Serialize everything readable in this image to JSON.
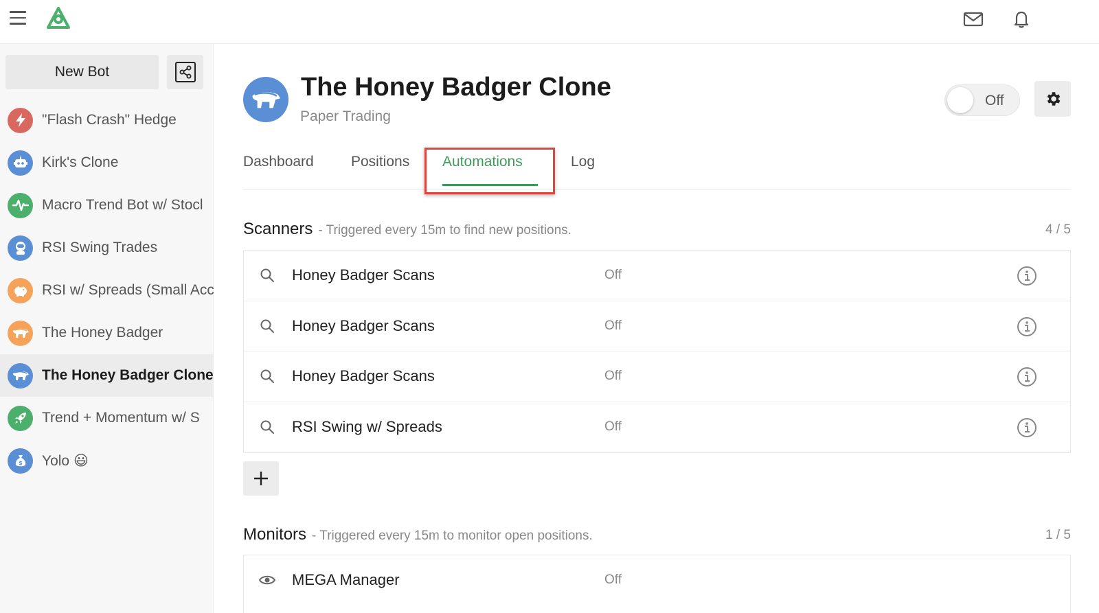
{
  "topbar": {
    "icons": [
      "menu-icon",
      "logo-icon",
      "mail-icon",
      "bell-icon"
    ]
  },
  "sidebar": {
    "new_bot_label": "New Bot",
    "share_icon": "share-icon",
    "items": [
      {
        "label": "\"Flash Crash\" Hedge",
        "icon": "lightning-icon",
        "color": "#d9695f"
      },
      {
        "label": "Kirk's Clone",
        "icon": "robot-icon",
        "color": "#5a8fd6"
      },
      {
        "label": "Macro Trend Bot w/ Stocl",
        "icon": "pulse-icon",
        "color": "#4caf6b"
      },
      {
        "label": "RSI Swing Trades",
        "icon": "astronaut-icon",
        "color": "#5a8fd6"
      },
      {
        "label": "RSI w/ Spreads (Small Acc",
        "icon": "piggy-bank-icon",
        "color": "#f5a35a"
      },
      {
        "label": "The Honey Badger",
        "icon": "badger-icon",
        "color": "#f5a35a"
      },
      {
        "label": "The Honey Badger Clone",
        "icon": "badger-icon",
        "color": "#5a8fd6",
        "active": true
      },
      {
        "label": "Trend + Momentum w/ S",
        "icon": "rocket-icon",
        "color": "#4caf6b"
      },
      {
        "label": "Yolo 😃",
        "icon": "money-bag-icon",
        "color": "#5a8fd6"
      }
    ]
  },
  "header": {
    "title": "The Honey Badger Clone",
    "subtitle": "Paper Trading",
    "toggle_label": "Off",
    "avatar_color": "#5a8fd6"
  },
  "tabs": [
    {
      "label": "Dashboard"
    },
    {
      "label": "Positions"
    },
    {
      "label": "Automations",
      "active": true
    },
    {
      "label": "Log"
    }
  ],
  "accent_color": "#3f9b5a",
  "highlight_color": "#e0443a",
  "scanners": {
    "title": "Scanners",
    "description": "- Triggered every 15m to find new positions.",
    "count": "4 / 5",
    "rows": [
      {
        "name": "Honey Badger Scans",
        "status": "Off"
      },
      {
        "name": "Honey Badger Scans",
        "status": "Off"
      },
      {
        "name": "Honey Badger Scans",
        "status": "Off"
      },
      {
        "name": "RSI Swing w/ Spreads",
        "status": "Off"
      }
    ]
  },
  "monitors": {
    "title": "Monitors",
    "description": "- Triggered every 15m to monitor open positions.",
    "count": "1 / 5",
    "rows": [
      {
        "name": "MEGA Manager",
        "status": "Off"
      }
    ]
  }
}
